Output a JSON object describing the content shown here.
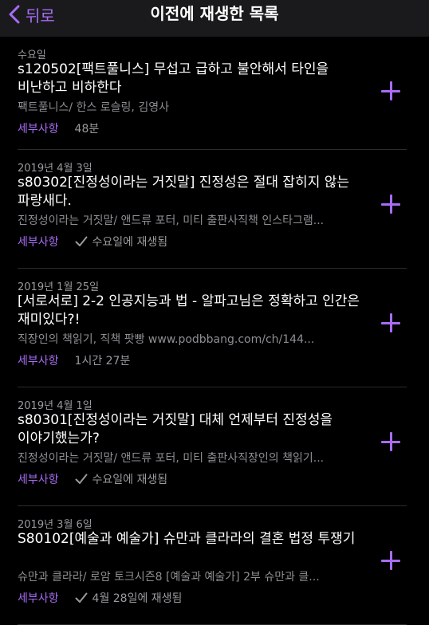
{
  "header": {
    "back_label": "뒤로",
    "title": "이전에 재생한 목록"
  },
  "accent_color": "#a76cf5",
  "episodes": [
    {
      "date": "수요일",
      "title": "s120502[팩트풀니스] 무섭고 급하고 불안해서 타인을 비난하고 비하한다",
      "meta": "팩트풀니스/ 한스 로슬링, 김영사",
      "details_label": "세부사항",
      "status": "48분",
      "played": false
    },
    {
      "date": "2019년 4월 3일",
      "title": "s80302[진정성이라는 거짓말] 진정성은 절대 잡히지 않는 파랑새다.",
      "meta": "진정성이라는 거짓말/ 앤드류 포터, 미티 출판사직책 인스타그램...",
      "details_label": "세부사항",
      "status": "수요일에 재생됨",
      "played": true
    },
    {
      "date": "2019년 1월 25일",
      "title": "[서로서로] 2-2 인공지능과 법 - 알파고님은 정확하고 인간은 재미있다?!",
      "meta": "직장인의 책읽기, 직책 팟빵   www.podbbang.com/ch/144...",
      "details_label": "세부사항",
      "status": "1시간 27분",
      "played": false
    },
    {
      "date": "2019년 4월 1일",
      "title": "s80301[진정성이라는 거짓말] 대체 언제부터 진정성을 이야기했는가?",
      "meta": "진정성이라는 거짓말/ 앤드류 포터, 미티 출판사직장인의 책읽기...",
      "details_label": "세부사항",
      "status": "수요일에 재생됨",
      "played": true
    },
    {
      "date": "2019년 3월 6일",
      "title": "S80102[예술과 예술가] 슈만과 클라라의 결혼 법정 투쟁기",
      "meta": "슈만과 클라라/ 로암 토크시즌8 [예술과 예술가] 2부 슈만과 클...",
      "details_label": "세부사항",
      "status": "4월 28일에 재생됨",
      "played": true
    }
  ]
}
